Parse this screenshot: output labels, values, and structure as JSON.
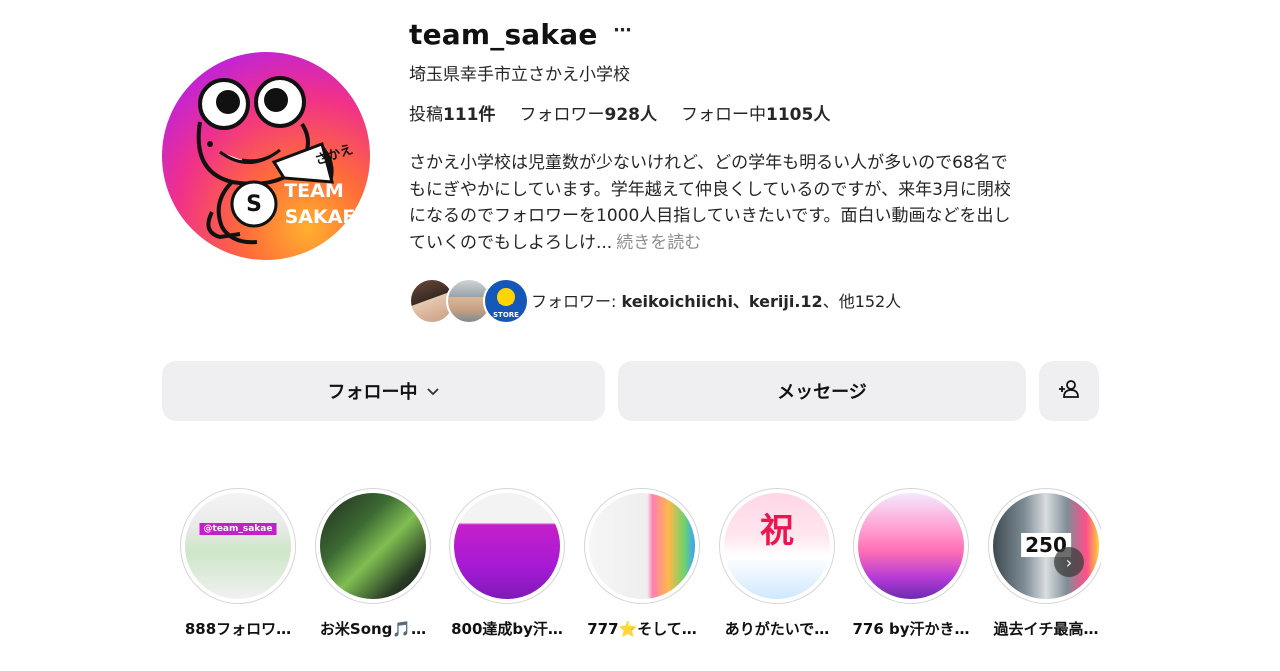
{
  "profile": {
    "username": "team_sakae",
    "more_icon": "⋯",
    "display_name": "埼玉県幸手市立さかえ小学校",
    "avatar_text_top": "さかえ",
    "avatar_text_1": "TEAM",
    "avatar_text_2": "SAKAE",
    "avatar_initial": "S"
  },
  "stats": {
    "posts_label": "投稿",
    "posts_value": "111件",
    "followers_label": "フォロワー",
    "followers_value": "928人",
    "following_label": "フォロー中",
    "following_value": "1105人"
  },
  "bio": {
    "line1": "さかえ小学校は児童数が少ないけれど、どの学年も明るい人が多いので68名で",
    "line2": "もにぎやかにしています。学年越えて仲良くしているのですが、来年3月に閉校",
    "line3": "になるのでフォロワーを1000人目指していきたいです。面白い動画などを出し",
    "line4": "ていくのでもしよろしけ...",
    "more": "続きを読む"
  },
  "followed_by": {
    "prefix": "フォロワー: ",
    "names": "keikoichiichi、keriji.12",
    "suffix": "、他152人",
    "badge3_text": "STORE"
  },
  "actions": {
    "following_label": "フォロー中",
    "message_label": "メッセージ",
    "add_user_icon": "add-user-icon"
  },
  "highlights": [
    {
      "label": "888フォロワ…",
      "thumb": "t1",
      "badge": "@team_sakae"
    },
    {
      "label": "お米Song🎵…",
      "thumb": "t2",
      "badge": ""
    },
    {
      "label": "800達成by汗…",
      "thumb": "t3",
      "badge": ""
    },
    {
      "label": "777⭐そして…",
      "thumb": "t4",
      "badge": ""
    },
    {
      "label": "ありがたいで…",
      "thumb": "t5",
      "badge": "祝"
    },
    {
      "label": "776 by汗かき…",
      "thumb": "t6",
      "badge": ""
    },
    {
      "label": "過去イチ最高…",
      "thumb": "t7",
      "badge": "250"
    }
  ],
  "colors": {
    "button_bg": "#efeff2",
    "link_gray": "#8e8e8e"
  }
}
